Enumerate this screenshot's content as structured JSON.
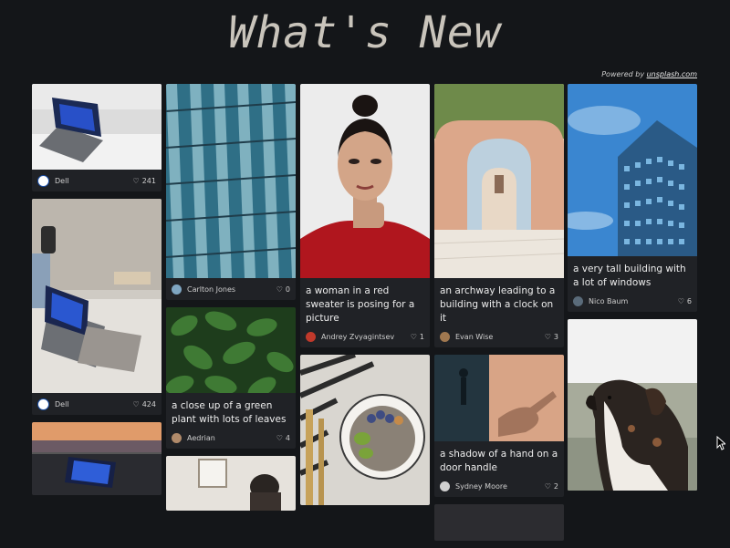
{
  "page": {
    "title": "What's New"
  },
  "powered": {
    "prefix": "Powered by ",
    "link": "unsplash.com"
  },
  "columns": [
    [
      {
        "kind": "laptop-white-desk",
        "caption": "",
        "author": "Dell",
        "likes": "241"
      },
      {
        "kind": "laptop-desk-lamp",
        "caption": "",
        "author": "Dell",
        "likes": "424"
      },
      {
        "kind": "laptop-sunset",
        "caption": "",
        "author": "",
        "likes": ""
      }
    ],
    [
      {
        "kind": "building-glass",
        "caption": "",
        "author": "Carlton Jones",
        "likes": "0"
      },
      {
        "kind": "green-plant",
        "caption": "a close up of a green plant with lots of leaves",
        "author": "Aedrian",
        "likes": "4"
      },
      {
        "kind": "room-person",
        "caption": "",
        "author": "",
        "likes": ""
      }
    ],
    [
      {
        "kind": "woman-red-sweater",
        "caption": "a woman in a red sweater is posing for a picture",
        "author": "Andrey Zvyagintsev",
        "likes": "1"
      },
      {
        "kind": "bowl-food",
        "caption": "",
        "author": "",
        "likes": ""
      }
    ],
    [
      {
        "kind": "archway",
        "caption": "an archway leading to a building with a clock on it",
        "author": "Evan Wise",
        "likes": "3"
      },
      {
        "kind": "door-shadow",
        "caption": "a shadow of a hand on a door handle",
        "author": "Sydney Moore",
        "likes": "2"
      },
      {
        "kind": "dark-bottom",
        "caption": "",
        "author": "",
        "likes": ""
      }
    ],
    [
      {
        "kind": "tall-building-blue",
        "caption": "a very tall building with a lot of windows",
        "author": "Nico Baum",
        "likes": "6"
      },
      {
        "kind": "dog-field",
        "caption": "",
        "author": "",
        "likes": ""
      }
    ]
  ],
  "colors": {
    "background": "#141619",
    "card": "#202226",
    "title": "#c9c4bb"
  }
}
